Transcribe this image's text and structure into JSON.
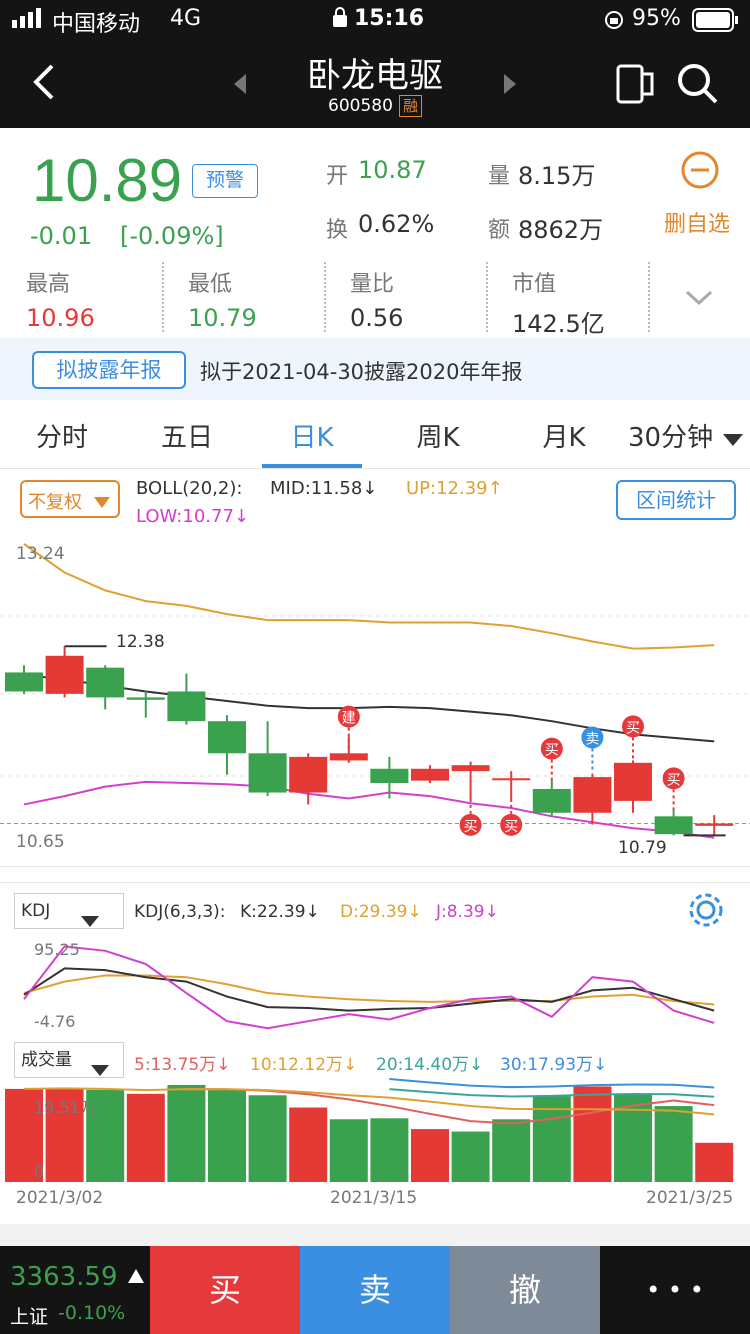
{
  "status": {
    "carrier": "中国移动",
    "network": "4G",
    "time": "15:16",
    "battery": "95%"
  },
  "header": {
    "title": "卧龙电驱",
    "code": "600580",
    "tag": "融"
  },
  "quote": {
    "price": "10.89",
    "change": "-0.01",
    "change_pct": "[-0.09%]",
    "alert_btn": "预警",
    "open_label": "开",
    "open": "10.87",
    "volume_label": "量",
    "volume": "8.15万",
    "turnover_label": "换",
    "turnover": "0.62%",
    "amount_label": "额",
    "amount": "8862万",
    "remove_fav": "删自选",
    "high_label": "最高",
    "high": "10.96",
    "low_label": "最低",
    "low": "10.79",
    "ratio_label": "量比",
    "ratio": "0.56",
    "mcap_label": "市值",
    "mcap": "142.5亿"
  },
  "notice": {
    "tag": "拟披露年报",
    "text": "拟于2021-04-30披露2020年年报"
  },
  "tabs": [
    "分时",
    "五日",
    "日K",
    "周K",
    "月K",
    "30分钟"
  ],
  "main_chart": {
    "adjust": "不复权",
    "boll_label": "BOLL(20,2):",
    "mid": "MID:11.58↓",
    "up": "UP:12.39↑",
    "low": "LOW:10.77↓",
    "range_btn": "区间统计",
    "y_top": "13.24",
    "y_bottom": "10.65",
    "max_label": "12.38",
    "min_label": "10.79",
    "markers": {
      "build": "建",
      "buy": "买",
      "sell": "卖"
    }
  },
  "kdj": {
    "selector": "KDJ",
    "params": "KDJ(6,3,3):",
    "k": "K:22.39↓",
    "d": "D:29.39↓",
    "j": "J:8.39↓",
    "y_top": "95.25",
    "y_bottom": "-4.76"
  },
  "volume": {
    "selector": "成交量",
    "ma5": "5:13.75万↓",
    "ma10": "10:12.12万↓",
    "ma20": "20:14.40万↓",
    "ma30": "30:17.93万↓",
    "y_top": "19.51万",
    "y_zero": "0"
  },
  "dates": [
    "2021/3/02",
    "2021/3/15",
    "2021/3/25"
  ],
  "index": {
    "value": "3363.59",
    "name": "上证",
    "pct": "-0.10%"
  },
  "actions": {
    "buy": "买",
    "sell": "卖",
    "cancel": "撤",
    "more": "• • •"
  },
  "colors": {
    "up": "#e53935",
    "down": "#3aa24e",
    "accent": "#3b8fe0",
    "boll_up": "#e0a030",
    "boll_low": "#d23fd0"
  },
  "chart_data": {
    "type": "candlestick",
    "y_range": [
      10.65,
      13.24
    ],
    "candles": [
      {
        "o": 12.16,
        "c": 12.0,
        "h": 12.22,
        "l": 11.98
      },
      {
        "o": 11.98,
        "c": 12.3,
        "h": 12.38,
        "l": 11.95
      },
      {
        "o": 12.2,
        "c": 11.95,
        "h": 12.22,
        "l": 11.85
      },
      {
        "o": 11.95,
        "c": 11.93,
        "h": 12.0,
        "l": 11.78
      },
      {
        "o": 12.0,
        "c": 11.75,
        "h": 12.15,
        "l": 11.72
      },
      {
        "o": 11.75,
        "c": 11.48,
        "h": 11.8,
        "l": 11.3
      },
      {
        "o": 11.48,
        "c": 11.15,
        "h": 11.75,
        "l": 11.12
      },
      {
        "o": 11.15,
        "c": 11.45,
        "h": 11.48,
        "l": 11.05
      },
      {
        "o": 11.42,
        "c": 11.48,
        "h": 11.62,
        "l": 11.4
      },
      {
        "o": 11.35,
        "c": 11.23,
        "h": 11.45,
        "l": 11.1
      },
      {
        "o": 11.25,
        "c": 11.35,
        "h": 11.38,
        "l": 11.23
      },
      {
        "o": 11.33,
        "c": 11.38,
        "h": 11.41,
        "l": 11.08
      },
      {
        "o": 11.27,
        "c": 11.27,
        "h": 11.33,
        "l": 11.08
      },
      {
        "o": 11.18,
        "c": 10.98,
        "h": 11.25,
        "l": 10.95
      },
      {
        "o": 10.98,
        "c": 11.28,
        "h": 11.31,
        "l": 10.88
      },
      {
        "o": 11.08,
        "c": 11.4,
        "h": 11.42,
        "l": 10.98
      },
      {
        "o": 10.95,
        "c": 10.8,
        "h": 11.0,
        "l": 10.79
      },
      {
        "o": 10.87,
        "c": 10.89,
        "h": 10.96,
        "l": 10.79
      }
    ],
    "boll_mid": [
      12.14,
      12.1,
      12.05,
      12.0,
      11.96,
      11.92,
      11.88,
      11.86,
      11.86,
      11.87,
      11.86,
      11.83,
      11.8,
      11.75,
      11.69,
      11.64,
      11.61,
      11.58
    ],
    "boll_up": [
      13.24,
      13.0,
      12.85,
      12.76,
      12.72,
      12.65,
      12.6,
      12.6,
      12.6,
      12.58,
      12.58,
      12.58,
      12.55,
      12.49,
      12.42,
      12.36,
      12.37,
      12.39
    ],
    "boll_low": [
      11.05,
      11.12,
      11.2,
      11.24,
      11.23,
      11.22,
      11.2,
      11.14,
      11.1,
      11.15,
      11.12,
      11.06,
      11.02,
      10.95,
      10.9,
      10.85,
      10.82,
      10.77
    ],
    "kdj": {
      "k": [
        40,
        70,
        68,
        60,
        55,
        38,
        26,
        25,
        22,
        24,
        25,
        30,
        35,
        32,
        45,
        48,
        35,
        22
      ],
      "d": [
        42,
        55,
        62,
        62,
        60,
        52,
        42,
        38,
        35,
        33,
        32,
        33,
        33,
        33,
        38,
        40,
        33,
        29
      ],
      "j": [
        35,
        95,
        90,
        75,
        42,
        10,
        2,
        10,
        18,
        12,
        25,
        35,
        38,
        15,
        60,
        55,
        22,
        8
      ]
    },
    "volume": {
      "values": [
        19.0,
        19.2,
        18.8,
        18.0,
        19.8,
        18.8,
        17.7,
        15.2,
        12.8,
        13.0,
        10.8,
        10.3,
        12.8,
        17.5,
        19.5,
        17.9,
        15.5,
        8.0
      ],
      "up": [
        true,
        true,
        false,
        true,
        false,
        false,
        false,
        true,
        false,
        false,
        true,
        false,
        false,
        false,
        true,
        false,
        false,
        true
      ]
    }
  }
}
